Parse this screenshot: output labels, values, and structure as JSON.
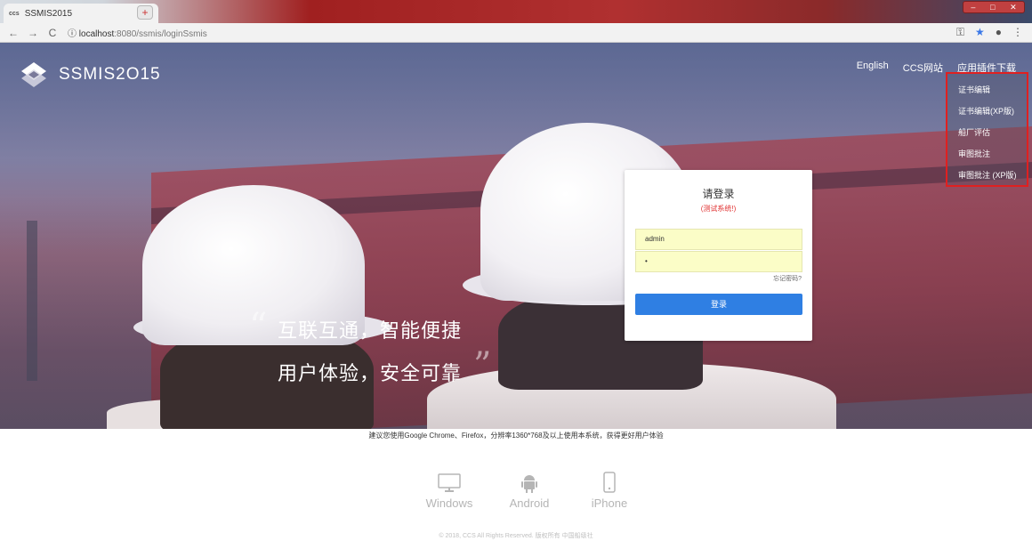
{
  "browser": {
    "tab_title": "SSMIS2015",
    "tab_favicon": "ccs",
    "tab_close": "×",
    "new_tab": "+",
    "back": "←",
    "forward": "→",
    "reload": "C",
    "info": "ⓘ",
    "url_host": "localhost",
    "url_rest": ":8080/ssmis/loginSsmis"
  },
  "header": {
    "logo_text": "SSMIS2O15",
    "nav": [
      "English",
      "CCS网站",
      "应用插件下载"
    ],
    "dropdown_items": [
      "证书编辑",
      "证书编辑(XP版)",
      "船厂评估",
      "审图批注",
      "审图批注 (XP版)"
    ]
  },
  "hero": {
    "slogan_line1": "互联互通，智能便捷",
    "slogan_line2": "用户体验，安全可靠"
  },
  "login": {
    "title": "请登录",
    "subtitle": "(测试系统!)",
    "username_value": "admin",
    "password_value": "•",
    "forgot_label": "忘记密码?",
    "submit_label": "登录"
  },
  "footer": {
    "advice": "建议您使用Google Chrome、Firefox，分辨率1360*768及以上使用本系统，获得更好用户体验",
    "platforms": [
      {
        "label": "Windows",
        "icon": "monitor-icon"
      },
      {
        "label": "Android",
        "icon": "android-icon"
      },
      {
        "label": "iPhone",
        "icon": "phone-icon"
      }
    ],
    "copyright": "© 2018, CCS All Rights Reserved. 版权所有 中国船级社"
  },
  "colors": {
    "accent_button": "#2f7fe3",
    "dropdown_highlight": "#e02020",
    "test_warning": "#e03030",
    "autofill_bg": "#fbfdc7"
  }
}
